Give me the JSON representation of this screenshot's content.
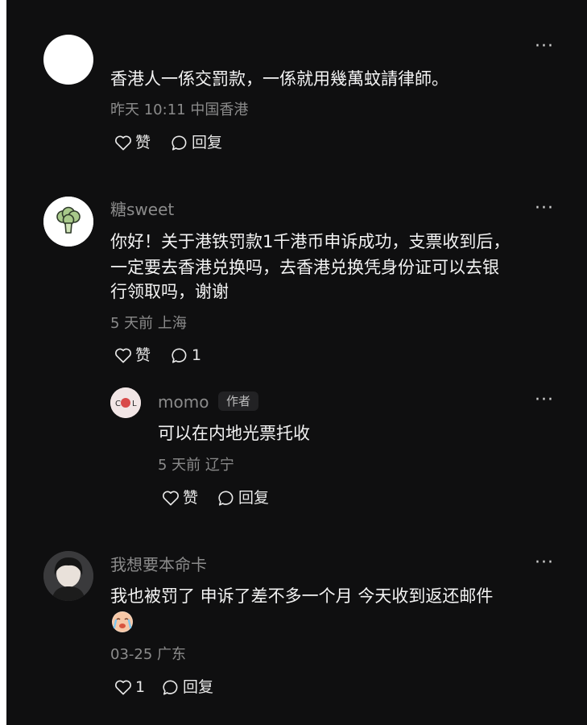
{
  "comments": [
    {
      "name": "",
      "text_lines": [
        "香港人一係交罰款，一係就用幾萬蚊請律師。"
      ],
      "meta": "昨天 10:11 中国香港",
      "like_label": "赞",
      "reply_label": "回复",
      "more": "···"
    },
    {
      "name": "糖sweet",
      "text_lines": [
        "你好！关于港铁罚款1千港币申诉成功，支票收到后，",
        "一定要去香港兑换吗，去香港兑换凭身份证可以去银",
        "行领取吗，谢谢"
      ],
      "meta": "5 天前 上海",
      "like_label": "赞",
      "reply_count": "1",
      "more": "···",
      "replies": [
        {
          "name": "momo",
          "author_tag": "作者",
          "avatar_text": "C·L",
          "text_lines": [
            "可以在内地光票托收"
          ],
          "meta": "5 天前 辽宁",
          "like_label": "赞",
          "reply_label": "回复",
          "more": "···"
        }
      ]
    },
    {
      "name": "我想要本命卡",
      "text_lines": [
        "我也被罚了 申诉了差不多一个月 今天收到返还邮件"
      ],
      "meta": "03-25 广东",
      "like_count": "1",
      "reply_label": "回复",
      "more": "···"
    }
  ],
  "icons": {
    "like": "heart-outline-icon",
    "reply": "speech-bubble-icon",
    "more": "more-dots-icon",
    "emoji": "crying-face-emoji"
  },
  "colors": {
    "background": "#0f0f10",
    "text": "#f3f3f3",
    "meta": "#8b8b8b"
  }
}
